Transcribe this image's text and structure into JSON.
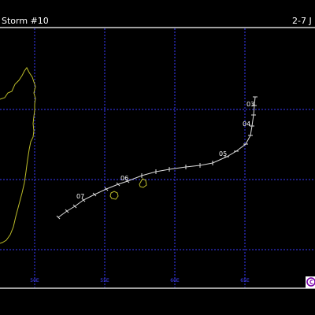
{
  "header": {
    "title": "Storm #10",
    "date_range": "2-7 J"
  },
  "map": {
    "longitude_labels": [
      "50E",
      "55E",
      "60E",
      "65E"
    ],
    "colors": {
      "background": "#000000",
      "frame": "#ffffff",
      "grid": "#3a3aff",
      "coastline": "#bdbd2a",
      "track": "#dddddd",
      "lon_label": "#4444ff"
    }
  },
  "track": {
    "day_labels": [
      "03",
      "04",
      "05",
      "06",
      "07"
    ]
  },
  "copyright_icon": "copyright-icon"
}
